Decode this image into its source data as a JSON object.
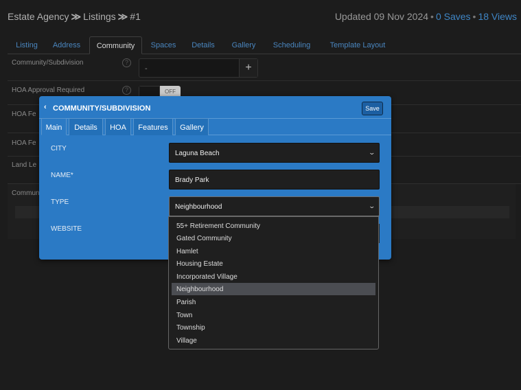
{
  "header": {
    "crumbs": [
      "Estate Agency",
      "Listings",
      "#1"
    ],
    "separator": "≫",
    "updated": "Updated 09 Nov 2024",
    "saves": "0 Saves",
    "views": "18 Views",
    "dot": "•"
  },
  "tabs": [
    "Listing",
    "Address",
    "Community",
    "Spaces",
    "Details",
    "Gallery",
    "Scheduling",
    "Template Layout"
  ],
  "active_tab": "Community",
  "rows": {
    "community": "Community/Subdivision",
    "hoa_approval": "HOA Approval Required",
    "hoa_fee1": "HOA Fe",
    "hoa_fee2": "HOA Fe",
    "land_lease": "Land Le",
    "community_notes": "Commun"
  },
  "bg_input_value": "-",
  "bg_plus": "+",
  "help_glyph": "?",
  "toggle_label": "OFF",
  "modal": {
    "back": "‹",
    "title": "COMMUNITY/SUBDIVISION",
    "save": "Save",
    "tabs": [
      "Main",
      "Details",
      "HOA",
      "Features",
      "Gallery"
    ],
    "active_tab": "Main",
    "city_label": "CITY",
    "city_value": "Laguna Beach",
    "name_label": "NAME*",
    "name_value": "Brady Park",
    "type_label": "TYPE",
    "type_value": "Neighbourhood",
    "website_label": "WEBSITE",
    "chevron": "⌄"
  },
  "type_options": [
    "55+ Retirement Community",
    "Gated Community",
    "Hamlet",
    "Housing Estate",
    "Incorporated Village",
    "Neighbourhood",
    "Parish",
    "Town",
    "Township",
    "Village"
  ],
  "selected_option": "Neighbourhood",
  "colors": {
    "accent": "#2b7ac5",
    "link": "#3f86c6",
    "background": "#1c1c1c"
  }
}
